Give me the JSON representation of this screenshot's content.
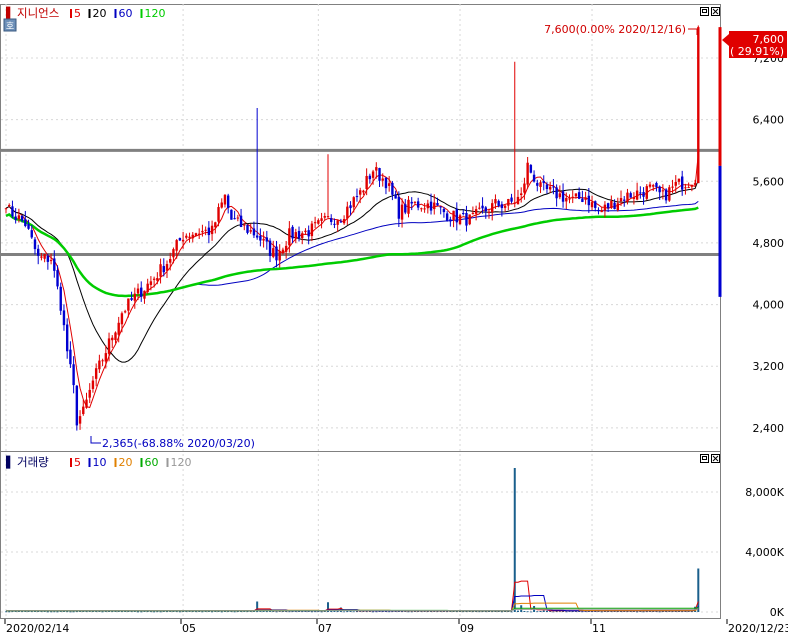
{
  "price_panel": {
    "legend_prefix": "▌",
    "stock_name": "지니언스",
    "ma_items": [
      {
        "label": "5",
        "color": "#e00000"
      },
      {
        "label": "20",
        "color": "#000000"
      },
      {
        "label": "60",
        "color": "#0000c0"
      },
      {
        "label": "120",
        "color": "#00cc00"
      }
    ],
    "badge": "호",
    "high_annotation": "7,600(0.00% 2020/12/16)",
    "low_annotation": "2,365(-68.88% 2020/03/20)",
    "last_price_tag": "7,600",
    "last_change_tag": "( 29.91%)"
  },
  "volume_panel": {
    "legend_prefix": "▌",
    "title": "거래량",
    "ma_items": [
      {
        "label": "5",
        "color": "#e00000"
      },
      {
        "label": "10",
        "color": "#0000c0"
      },
      {
        "label": "20",
        "color": "#e08000"
      },
      {
        "label": "60",
        "color": "#00aa00"
      },
      {
        "label": "120",
        "color": "#999999"
      }
    ]
  },
  "chart_data": [
    {
      "type": "candlestick",
      "name": "지니언스",
      "x_labels": [
        "2020/02/14",
        "05",
        "07",
        "09",
        "11",
        "2020/12/23"
      ],
      "y_ticks": [
        "2,400",
        "3,200",
        "4,000",
        "4,800",
        "5,600",
        "6,400",
        "7,200"
      ],
      "ylim": [
        2100,
        7900
      ],
      "horizontal_lines": [
        6000,
        4650
      ],
      "high": {
        "value": 7600,
        "date": "2020/12/16"
      },
      "low": {
        "value": 2365,
        "date": "2020/03/20"
      },
      "anchors_close": [
        [
          0,
          5250
        ],
        [
          6,
          5050
        ],
        [
          10,
          4600
        ],
        [
          14,
          4600
        ],
        [
          17,
          4000
        ],
        [
          19,
          3400
        ],
        [
          21,
          2900
        ],
        [
          22,
          2500
        ],
        [
          24,
          2600
        ],
        [
          27,
          3000
        ],
        [
          30,
          3300
        ],
        [
          33,
          3600
        ],
        [
          36,
          3900
        ],
        [
          40,
          4100
        ],
        [
          45,
          4300
        ],
        [
          50,
          4550
        ],
        [
          55,
          4900
        ],
        [
          60,
          4950
        ],
        [
          64,
          4950
        ],
        [
          66,
          5200
        ],
        [
          68,
          5400
        ],
        [
          70,
          5100
        ],
        [
          74,
          5000
        ],
        [
          78,
          4900
        ],
        [
          82,
          4700
        ],
        [
          84,
          4650
        ],
        [
          88,
          4900
        ],
        [
          94,
          4950
        ],
        [
          100,
          5100
        ],
        [
          104,
          5150
        ],
        [
          110,
          5450
        ],
        [
          114,
          5750
        ],
        [
          118,
          5600
        ],
        [
          122,
          5200
        ],
        [
          126,
          5300
        ],
        [
          132,
          5300
        ],
        [
          138,
          5150
        ],
        [
          144,
          5100
        ],
        [
          148,
          5200
        ],
        [
          152,
          5300
        ],
        [
          156,
          5300
        ],
        [
          160,
          5400
        ],
        [
          162,
          5800
        ],
        [
          166,
          5500
        ],
        [
          170,
          5450
        ],
        [
          176,
          5350
        ],
        [
          180,
          5400
        ],
        [
          184,
          5200
        ],
        [
          188,
          5300
        ],
        [
          192,
          5400
        ],
        [
          196,
          5450
        ],
        [
          200,
          5500
        ],
        [
          204,
          5400
        ],
        [
          208,
          5550
        ],
        [
          212,
          5600
        ],
        [
          214,
          5650
        ],
        [
          215,
          7600
        ]
      ],
      "spikes": [
        {
          "i": 78,
          "high": 6550
        },
        {
          "i": 100,
          "high": 5950
        },
        {
          "i": 158,
          "high": 7150
        }
      ],
      "moving_averages": [
        {
          "period": 5,
          "color": "#e00000"
        },
        {
          "period": 20,
          "color": "#000000"
        },
        {
          "period": 60,
          "color": "#0000c0"
        },
        {
          "period": 120,
          "color": "#00cc00"
        }
      ]
    },
    {
      "type": "bar",
      "name": "거래량",
      "y_ticks": [
        "0K",
        "4,000K",
        "8,000K"
      ],
      "ylim": [
        0,
        9800
      ],
      "unit": "K",
      "base_level": 80,
      "spikes": [
        {
          "i": 78,
          "value": 700
        },
        {
          "i": 100,
          "value": 650
        },
        {
          "i": 104,
          "value": 300
        },
        {
          "i": 158,
          "value": 9600
        },
        {
          "i": 160,
          "value": 450
        },
        {
          "i": 164,
          "value": 400
        },
        {
          "i": 214,
          "value": 350
        },
        {
          "i": 215,
          "value": 2900
        }
      ]
    }
  ]
}
